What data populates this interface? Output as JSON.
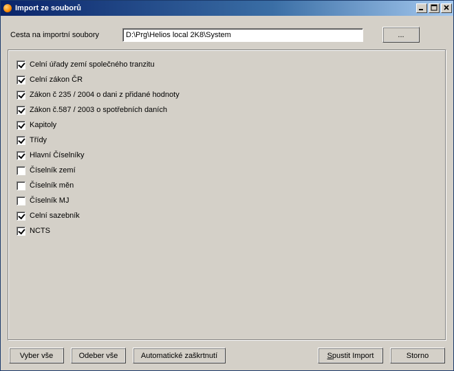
{
  "window": {
    "title": "Import ze souborů"
  },
  "path": {
    "label": "Cesta na importní soubory",
    "value": "D:\\Prg\\Helios local 2K8\\System",
    "browse_label": "..."
  },
  "items": [
    {
      "label": "Celní úřady zemí společného tranzitu",
      "checked": true
    },
    {
      "label": "Celní zákon ČR",
      "checked": true
    },
    {
      "label": "Zákon č 235 / 2004 o dani z přidané hodnoty",
      "checked": true
    },
    {
      "label": "Zákon č.587 / 2003 o spotřebních daních",
      "checked": true
    },
    {
      "label": "Kapitoly",
      "checked": true
    },
    {
      "label": "Třídy",
      "checked": true
    },
    {
      "label": "Hlavní Číselníky",
      "checked": true
    },
    {
      "label": "Číselník zemí",
      "checked": false
    },
    {
      "label": "Číselník měn",
      "checked": false
    },
    {
      "label": "Číselník MJ",
      "checked": false
    },
    {
      "label": "Celní sazebník",
      "checked": true
    },
    {
      "label": "NCTS",
      "checked": true
    }
  ],
  "buttons": {
    "select_all": "Vyber vše",
    "deselect_all": "Odeber vše",
    "auto_check": "Automatické zaškrtnutí",
    "run_import": "Spustit Import",
    "cancel": "Storno"
  }
}
